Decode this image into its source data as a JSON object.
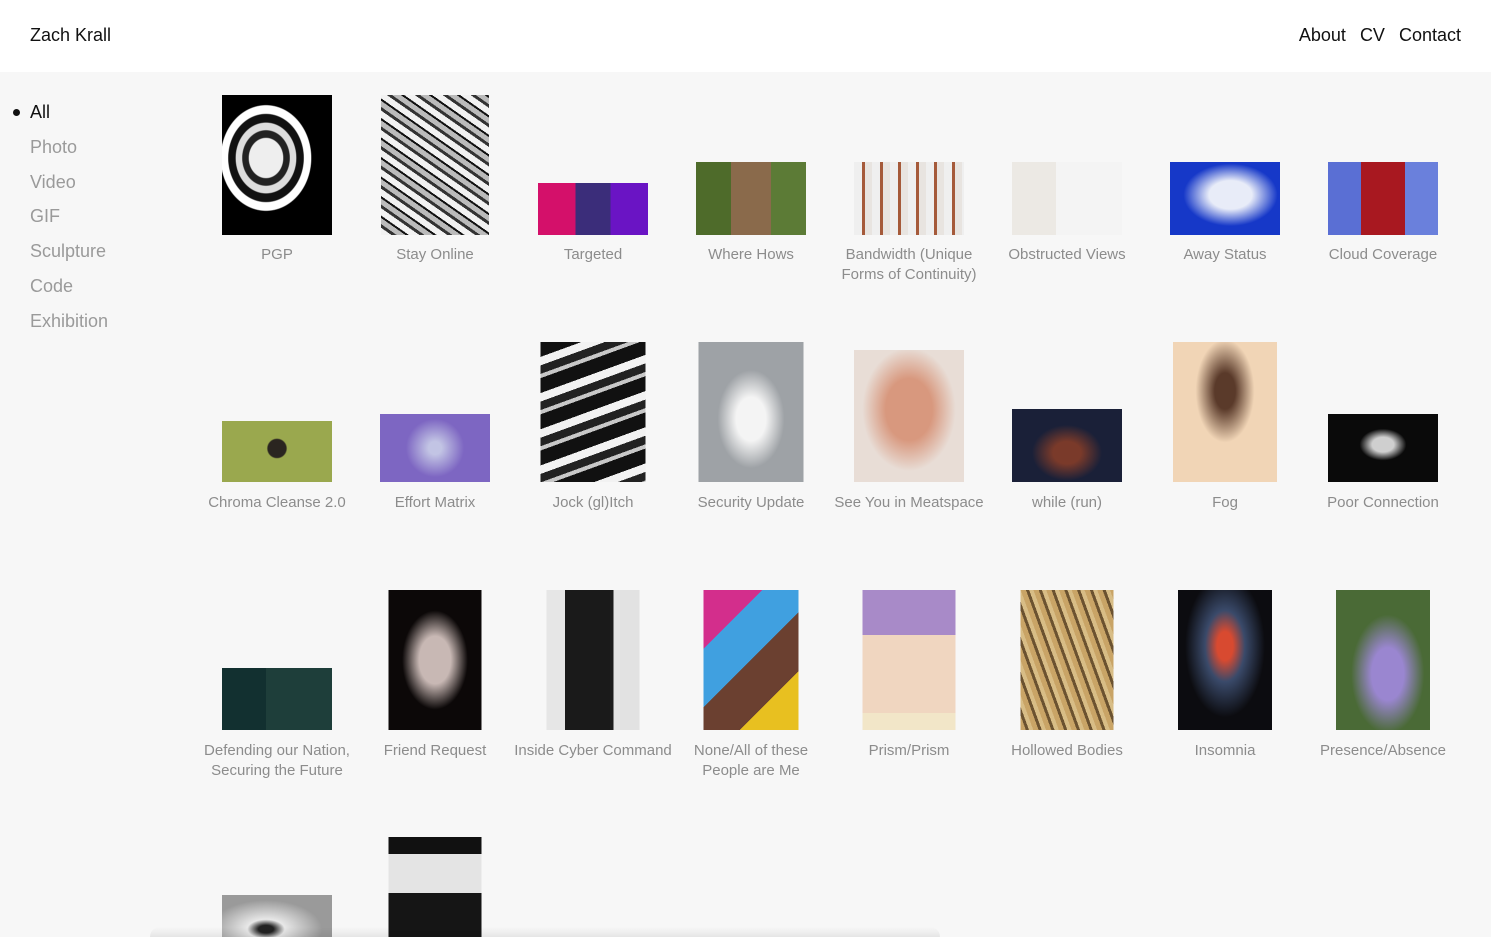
{
  "header": {
    "title": "Zach Krall",
    "nav": [
      "About",
      "CV",
      "Contact"
    ]
  },
  "filters": [
    "All",
    "Photo",
    "Video",
    "GIF",
    "Sculpture",
    "Code",
    "Exhibition"
  ],
  "active_filter": "All",
  "works": [
    {
      "title": "PGP",
      "icon": "pgp-thumbnail"
    },
    {
      "title": "Stay Online",
      "icon": "stay-online-thumbnail"
    },
    {
      "title": "Targeted",
      "icon": "targeted-thumbnail"
    },
    {
      "title": "Where Hows",
      "icon": "where-hows-thumbnail"
    },
    {
      "title": "Bandwidth (Unique Forms of Continuity)",
      "icon": "bandwidth-thumbnail"
    },
    {
      "title": "Obstructed Views",
      "icon": "obstructed-views-thumbnail"
    },
    {
      "title": "Away Status",
      "icon": "away-status-thumbnail"
    },
    {
      "title": "Cloud Coverage",
      "icon": "cloud-coverage-thumbnail"
    },
    {
      "title": "Chroma Cleanse 2.0",
      "icon": "chroma-cleanse-thumbnail"
    },
    {
      "title": "Effort Matrix",
      "icon": "effort-matrix-thumbnail"
    },
    {
      "title": "Jock (gl)Itch",
      "icon": "jock-glitch-thumbnail"
    },
    {
      "title": "Security Update",
      "icon": "security-update-thumbnail"
    },
    {
      "title": "See You in Meatspace",
      "icon": "see-you-in-meatspace-thumbnail"
    },
    {
      "title": "while (run)",
      "icon": "while-run-thumbnail"
    },
    {
      "title": "Fog",
      "icon": "fog-thumbnail"
    },
    {
      "title": "Poor Connection",
      "icon": "poor-connection-thumbnail"
    },
    {
      "title": "Defending our Nation, Securing the Future",
      "icon": "defending-our-nation-thumbnail"
    },
    {
      "title": "Friend Request",
      "icon": "friend-request-thumbnail"
    },
    {
      "title": "Inside Cyber Command",
      "icon": "inside-cyber-command-thumbnail"
    },
    {
      "title": "None/All of these People are Me",
      "icon": "none-all-people-thumbnail"
    },
    {
      "title": "Prism/Prism",
      "icon": "prism-prism-thumbnail"
    },
    {
      "title": "Hollowed Bodies",
      "icon": "hollowed-bodies-thumbnail"
    },
    {
      "title": "Insomnia",
      "icon": "insomnia-thumbnail"
    },
    {
      "title": "Presence/Absence",
      "icon": "presence-absence-thumbnail"
    },
    {
      "title": "",
      "icon": "eye-portrait-thumbnail"
    },
    {
      "title": "",
      "icon": "black-drip-sculpture-thumbnail"
    }
  ]
}
